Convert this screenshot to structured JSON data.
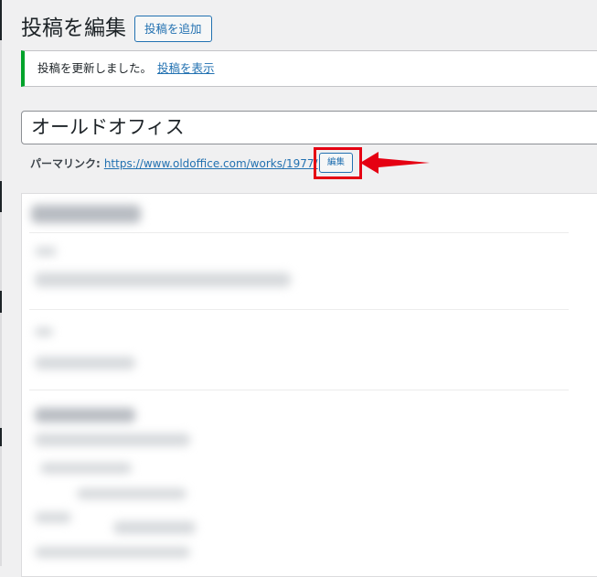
{
  "header": {
    "title": "投稿を編集",
    "add_new_label": "投稿を追加"
  },
  "notice": {
    "message": "投稿を更新しました。",
    "link_text": "投稿を表示",
    "status_color": "#00a32a"
  },
  "post": {
    "title_value": "オールドオフィス"
  },
  "permalink": {
    "label": "パーマリンク:",
    "url": "https://www.oldoffice.com/works/1977/",
    "edit_label": "編集"
  },
  "annotation": {
    "highlight_color": "#e50012",
    "arrow_icon": "red-arrow-left"
  },
  "editor": {
    "content_state": "blurred"
  }
}
